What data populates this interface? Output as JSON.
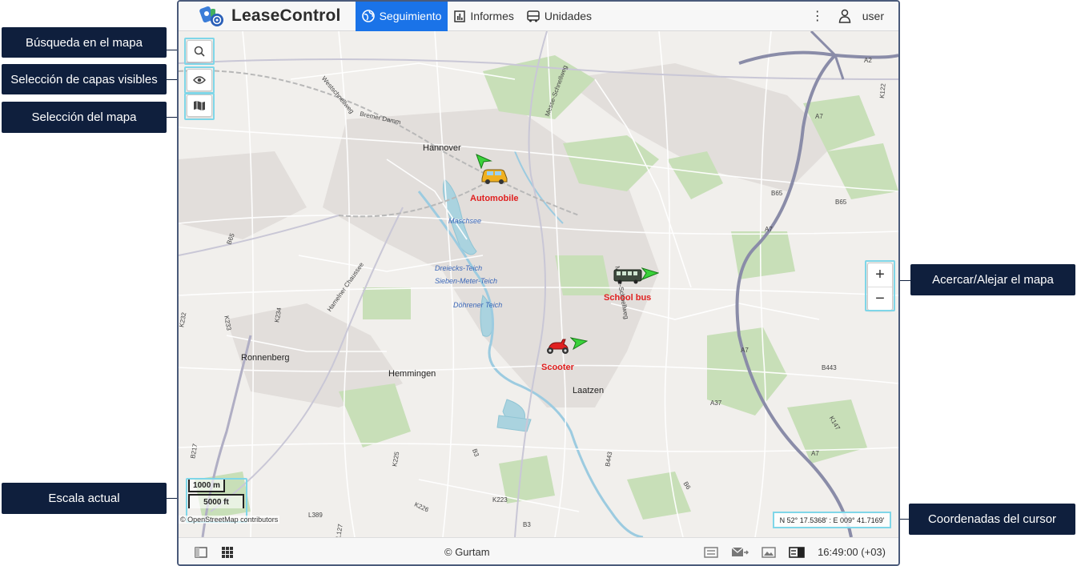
{
  "app": {
    "brand": "LeaseControl",
    "nav": [
      {
        "label": "Seguimiento",
        "icon": "globe-icon",
        "active": true
      },
      {
        "label": "Informes",
        "icon": "report-icon",
        "active": false
      },
      {
        "label": "Unidades",
        "icon": "bus-icon",
        "active": false
      }
    ],
    "user": "user",
    "accent": "#1a73e8"
  },
  "map": {
    "places": [
      "Hannover",
      "Ronnenberg",
      "Hemmingen",
      "Laatzen"
    ],
    "water": [
      "Maschsee",
      "Dreiecks-Teich",
      "Sieben-Meter-Teich",
      "Döhrener Teich"
    ],
    "roads": [
      "Westschnellweg",
      "Bremer Damm",
      "Messe-Schnellweg",
      "Hamelner Chaussee",
      "B65",
      "B65",
      "B65",
      "A7",
      "A7",
      "A7",
      "A7",
      "A37",
      "B443",
      "B443",
      "B3",
      "B3",
      "B6",
      "B217",
      "K225",
      "K226",
      "K223",
      "K234",
      "K233",
      "K232",
      "K147",
      "K122",
      "L389",
      "L127",
      "A2",
      "Messe-Schnellweg"
    ],
    "units": [
      {
        "name": "Automobile",
        "icon": "car-icon"
      },
      {
        "name": "School bus",
        "icon": "bus-icon"
      },
      {
        "name": "Scooter",
        "icon": "scooter-icon"
      }
    ],
    "scale_metric": "1000 m",
    "scale_imperial": "5000 ft",
    "attribution": "© OpenStreetMap contributors",
    "cursor_coords": "N 52° 17.5368' : E 009° 41.7169'",
    "zoom_in": "+",
    "zoom_out": "−"
  },
  "bottom": {
    "copyright": "© Gurtam",
    "clock": "16:49:00 (+03)"
  },
  "callouts": {
    "search": "Búsqueda en el mapa",
    "layers": "Selección de capas visibles",
    "map_select": "Selección del mapa",
    "scale": "Escala actual",
    "zoom": "Acercar/Alejar el mapa",
    "coords": "Coordenadas del cursor"
  },
  "colors": {
    "callout_bg": "#0f1f3d",
    "highlight": "#7fd6e8",
    "unit_label": "#e02020",
    "motorway": "#8a8ca8",
    "water": "#aad3df",
    "park": "#c8dfb8"
  }
}
